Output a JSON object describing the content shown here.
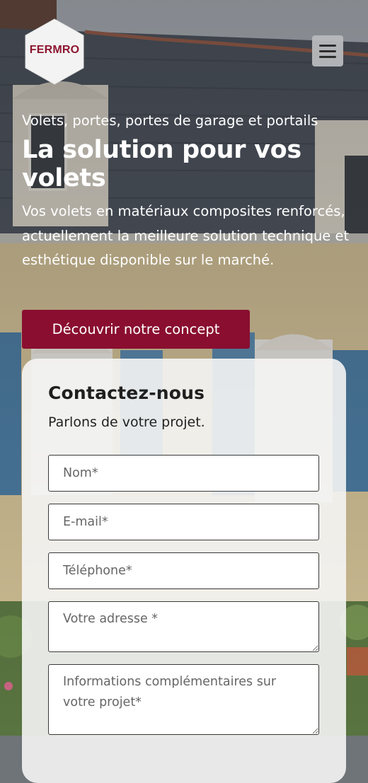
{
  "brand": {
    "logo_text": "FERMRO",
    "logo_color": "#8c1530"
  },
  "header": {
    "menu_icon": "hamburger-menu-icon"
  },
  "hero": {
    "kicker": "Volets, portes, portes de garage et portails",
    "headline": "La solution pour vos volets",
    "lead": "Vos volets en matériaux composites renforcés, actuellement la meilleure solution technique et esthétique disponible sur le marché.",
    "cta_label": "Découvrir notre concept"
  },
  "contact": {
    "title": "Contactez-nous",
    "subtitle": "Parlons de votre projet.",
    "fields": {
      "name_placeholder": "Nom*",
      "email_placeholder": "E-mail*",
      "phone_placeholder": "Téléphone*",
      "address_placeholder": "Votre adresse *",
      "info_placeholder": "Informations complémentaires sur votre projet*"
    }
  },
  "colors": {
    "accent": "#8a0e30",
    "text_light": "#ffffff"
  }
}
